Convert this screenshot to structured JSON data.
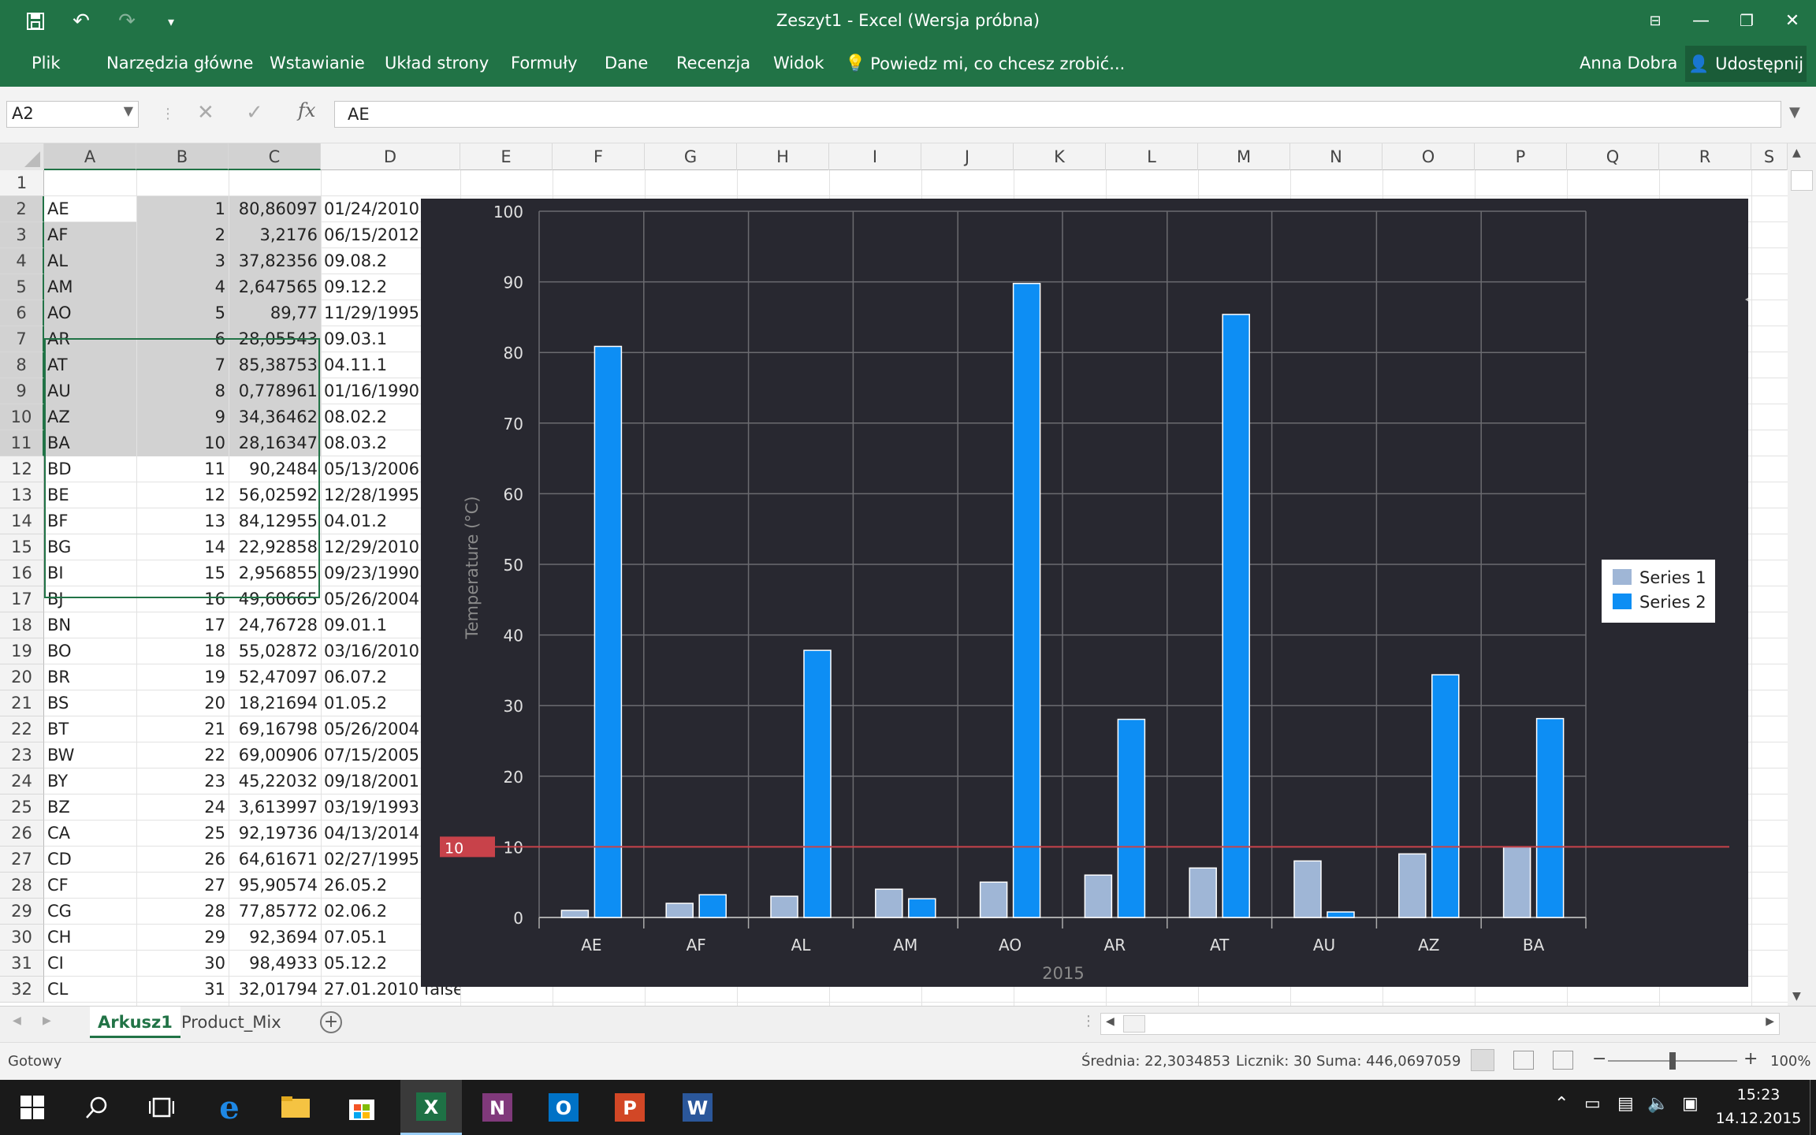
{
  "window": {
    "title": "Zeszyt1 - Excel (Wersja próbna)"
  },
  "ribbon": {
    "tabs": [
      "Plik",
      "Narzędzia główne",
      "Wstawianie",
      "Układ strony",
      "Formuły",
      "Dane",
      "Recenzja",
      "Widok"
    ],
    "tell_me": "Powiedz mi, co chcesz zrobić...",
    "user": "Anna Dobra",
    "share": "Udostępnij"
  },
  "formula_bar": {
    "name_box": "A2",
    "fx": "fx",
    "content": "AE"
  },
  "columns": [
    "A",
    "B",
    "C",
    "D",
    "E",
    "F",
    "G",
    "H",
    "I",
    "J",
    "K",
    "L",
    "M",
    "N",
    "O",
    "P",
    "Q",
    "R",
    "S"
  ],
  "rows": [
    {
      "n": "1",
      "a": "",
      "b": "",
      "c": "",
      "d": ""
    },
    {
      "n": "2",
      "a": "AE",
      "b": "1",
      "c": "80,86097",
      "d": "01/24/2010"
    },
    {
      "n": "3",
      "a": "AF",
      "b": "2",
      "c": "3,2176",
      "d": "06/15/2012"
    },
    {
      "n": "4",
      "a": "AL",
      "b": "3",
      "c": "37,82356",
      "d": "09.08.2"
    },
    {
      "n": "5",
      "a": "AM",
      "b": "4",
      "c": "2,647565",
      "d": "09.12.2"
    },
    {
      "n": "6",
      "a": "AO",
      "b": "5",
      "c": "89,77",
      "d": "11/29/1995"
    },
    {
      "n": "7",
      "a": "AR",
      "b": "6",
      "c": "28,05543",
      "d": "09.03.1"
    },
    {
      "n": "8",
      "a": "AT",
      "b": "7",
      "c": "85,38753",
      "d": "04.11.1"
    },
    {
      "n": "9",
      "a": "AU",
      "b": "8",
      "c": "0,778961",
      "d": "01/16/1990"
    },
    {
      "n": "10",
      "a": "AZ",
      "b": "9",
      "c": "34,36462",
      "d": "08.02.2"
    },
    {
      "n": "11",
      "a": "BA",
      "b": "10",
      "c": "28,16347",
      "d": "08.03.2"
    },
    {
      "n": "12",
      "a": "BD",
      "b": "11",
      "c": "90,2484",
      "d": "05/13/2006"
    },
    {
      "n": "13",
      "a": "BE",
      "b": "12",
      "c": "56,02592",
      "d": "12/28/1995"
    },
    {
      "n": "14",
      "a": "BF",
      "b": "13",
      "c": "84,12955",
      "d": "04.01.2"
    },
    {
      "n": "15",
      "a": "BG",
      "b": "14",
      "c": "22,92858",
      "d": "12/29/2010"
    },
    {
      "n": "16",
      "a": "BI",
      "b": "15",
      "c": "2,956855",
      "d": "09/23/1990"
    },
    {
      "n": "17",
      "a": "BJ",
      "b": "16",
      "c": "49,60665",
      "d": "05/26/2004"
    },
    {
      "n": "18",
      "a": "BN",
      "b": "17",
      "c": "24,76728",
      "d": "09.01.1"
    },
    {
      "n": "19",
      "a": "BO",
      "b": "18",
      "c": "55,02872",
      "d": "03/16/2010"
    },
    {
      "n": "20",
      "a": "BR",
      "b": "19",
      "c": "52,47097",
      "d": "06.07.2"
    },
    {
      "n": "21",
      "a": "BS",
      "b": "20",
      "c": "18,21694",
      "d": "01.05.2"
    },
    {
      "n": "22",
      "a": "BT",
      "b": "21",
      "c": "69,16798",
      "d": "05/26/2004"
    },
    {
      "n": "23",
      "a": "BW",
      "b": "22",
      "c": "69,00906",
      "d": "07/15/2005"
    },
    {
      "n": "24",
      "a": "BY",
      "b": "23",
      "c": "45,22032",
      "d": "09/18/2001"
    },
    {
      "n": "25",
      "a": "BZ",
      "b": "24",
      "c": "3,613997",
      "d": "03/19/1993"
    },
    {
      "n": "26",
      "a": "CA",
      "b": "25",
      "c": "92,19736",
      "d": "04/13/2014"
    },
    {
      "n": "27",
      "a": "CD",
      "b": "26",
      "c": "64,61671",
      "d": "02/27/1995"
    },
    {
      "n": "28",
      "a": "CF",
      "b": "27",
      "c": "95,90574",
      "d": "26.05.2"
    },
    {
      "n": "29",
      "a": "CG",
      "b": "28",
      "c": "77,85772",
      "d": "02.06.2"
    },
    {
      "n": "30",
      "a": "CH",
      "b": "29",
      "c": "92,3694",
      "d": "07.05.1"
    },
    {
      "n": "31",
      "a": "CI",
      "b": "30",
      "c": "98,4933",
      "d": "05.12.2"
    },
    {
      "n": "32",
      "a": "CL",
      "b": "31",
      "c": "32,01794",
      "d": "27.01.2010 false"
    }
  ],
  "chart_data": {
    "type": "bar",
    "categories": [
      "AE",
      "AF",
      "AL",
      "AM",
      "AO",
      "AR",
      "AT",
      "AU",
      "AZ",
      "BA"
    ],
    "series": [
      {
        "name": "Series 1",
        "color": "#9fb6d6",
        "values": [
          1,
          2,
          3,
          4,
          5,
          6,
          7,
          8,
          9,
          10
        ]
      },
      {
        "name": "Series 2",
        "color": "#0d8ef4",
        "values": [
          80.86097,
          3.2176,
          37.82356,
          2.647565,
          89.77,
          28.05543,
          85.38753,
          0.778961,
          34.36462,
          28.16347
        ]
      }
    ],
    "ylabel": "Temperature (°C)",
    "xlabel": "2015",
    "ylim": [
      0,
      100
    ],
    "yticks": [
      0,
      10,
      20,
      30,
      40,
      50,
      60,
      70,
      80,
      90,
      100
    ],
    "threshold": {
      "value": 10,
      "label": "10",
      "color": "#c8424a"
    },
    "legend_position": "right",
    "grid": true
  },
  "sheets": {
    "tabs": [
      "Arkusz1",
      "Product_Mix"
    ],
    "active": "Arkusz1"
  },
  "status": {
    "ready": "Gotowy",
    "average": "Średnia: 22,3034853",
    "count": "Licznik: 30",
    "sum": "Suma: 446,0697059",
    "zoom": "100%"
  },
  "taskbar": {
    "time": "15:23",
    "date": "14.12.2015"
  }
}
